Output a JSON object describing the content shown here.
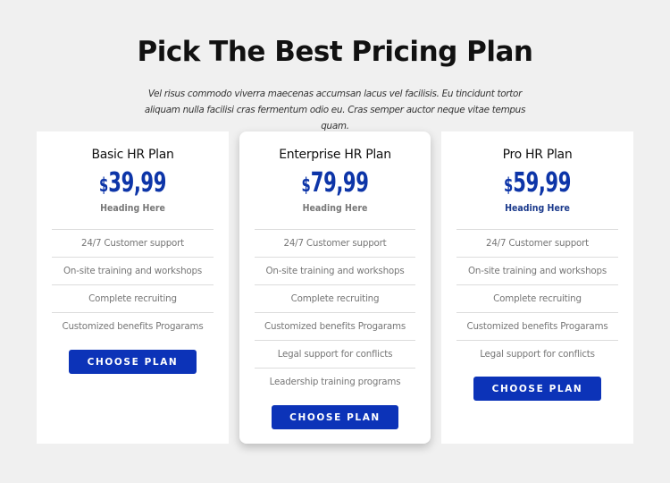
{
  "header": {
    "title": "Pick The Best Pricing Plan",
    "subtitle": "Vel risus commodo viverra maecenas accumsan lacus vel facilisis. Eu tincidunt tortor aliquam nulla facilisi cras fermentum odio eu. Cras semper auctor neque vitae tempus quam."
  },
  "colors": {
    "background": "#f0f0f0",
    "price": "#0d35a8",
    "button": "#0c33b8",
    "pro_heading": "#1b3a8c"
  },
  "plans": [
    {
      "name": "Basic HR Plan",
      "currency": "$",
      "price": "39,99",
      "heading": "Heading Here",
      "features": [
        "24/7 Customer support",
        "On-site training and workshops",
        "Complete recruiting",
        "Customized benefits Progarams"
      ],
      "button": "CHOOSE PLAN"
    },
    {
      "name": "Enterprise HR Plan",
      "currency": "$",
      "price": "79,99",
      "heading": "Heading Here",
      "features": [
        "24/7 Customer support",
        "On-site training and workshops",
        "Complete recruiting",
        "Customized benefits Progarams",
        "Legal support for conflicts",
        "Leadership training programs"
      ],
      "button": "CHOOSE PLAN"
    },
    {
      "name": "Pro HR Plan",
      "currency": "$",
      "price": "59,99",
      "heading": "Heading Here",
      "features": [
        "24/7 Customer support",
        "On-site training and workshops",
        "Complete recruiting",
        "Customized benefits Progarams",
        "Legal support for conflicts"
      ],
      "button": "CHOOSE PLAN"
    }
  ]
}
